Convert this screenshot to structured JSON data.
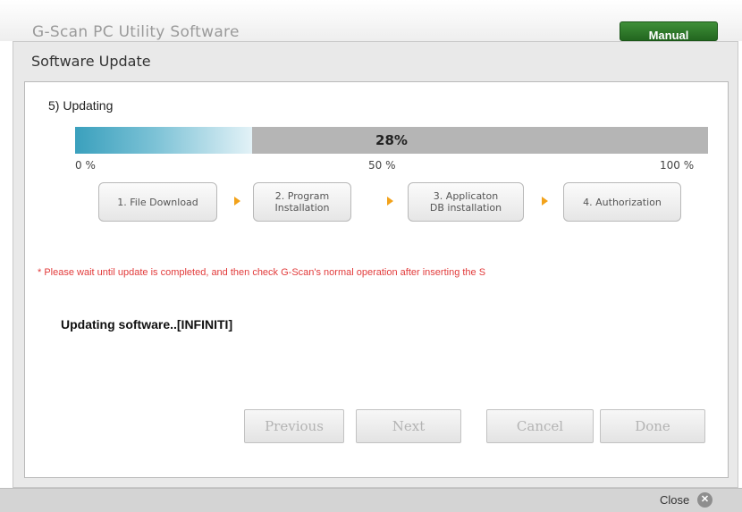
{
  "app": {
    "title": "G-Scan PC Utility Software",
    "manual_label": "Manual"
  },
  "dialog": {
    "title": "Software Update",
    "step_heading": "5) Updating",
    "progress": {
      "value": 0.28,
      "percent_label": "28%",
      "ticks": [
        "0 %",
        "50 %",
        "100 %"
      ]
    },
    "stages": [
      "1. File Download",
      "2. Program\nInstallation",
      "3. Applicaton\nDB installation",
      "4. Authorization"
    ],
    "notice": "* Please wait until update is completed, and then check G-Scan's normal operation after inserting the S",
    "status": "Updating software..[INFINITI]",
    "buttons": {
      "previous": "Previous",
      "next": "Next",
      "cancel": "Cancel",
      "done": "Done"
    }
  },
  "bottom": {
    "close_label": "Close",
    "close_icon": "close-circle-icon"
  },
  "colors": {
    "progress_fill": "#3aa0bd",
    "progress_track": "#b5b5b5",
    "notice": "#e23b3b",
    "arrow": "#f2a21b",
    "manual_button": "#2f7a2a"
  }
}
